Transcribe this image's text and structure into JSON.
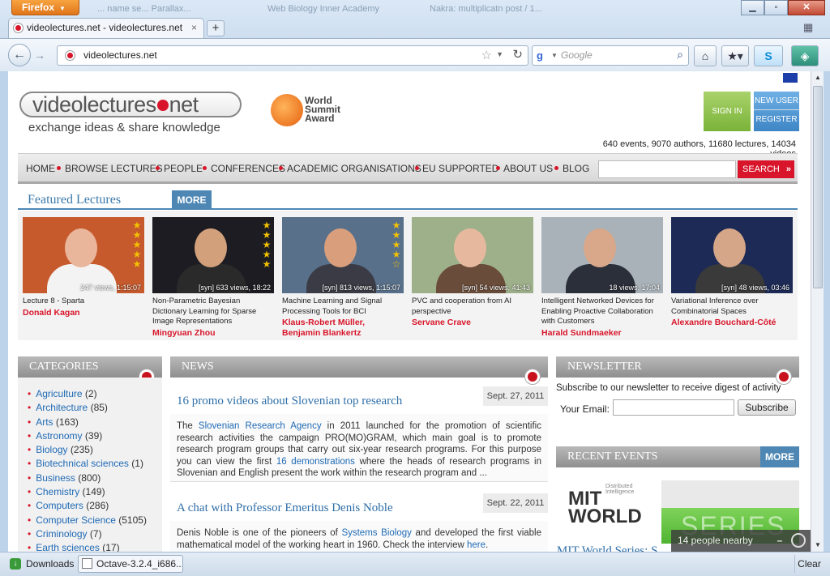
{
  "browser": {
    "app_button": "Firefox",
    "ghost_tabs": [
      "... name se... Parallax...",
      "Web Biology Inner Academy",
      "Nakra: multiplicatn post / 1..."
    ],
    "tab_title": "videolectures.net - videolectures.net",
    "url": "videolectures.net",
    "search_placeholder": "Google",
    "new_tab": "+"
  },
  "site": {
    "logo_pre": "videolectures",
    "logo_post": "net",
    "tagline": "exchange ideas & share knowledge",
    "award": [
      "World",
      "Summit",
      "Award"
    ],
    "sign_in": "SIGN IN",
    "new_user": "NEW USER",
    "register": "REGISTER",
    "stats": "640 events, 9070 authors, 11680 lectures, 14034 videos"
  },
  "menu": {
    "items": [
      "HOME",
      "BROWSE LECTURES",
      "PEOPLE",
      "CONFERENCES",
      "ACADEMIC ORGANISATIONS",
      "EU SUPPORTED",
      "ABOUT US",
      "BLOG"
    ],
    "search": "SEARCH"
  },
  "featured": {
    "title": "Featured Lectures",
    "more": "MORE",
    "cards": [
      {
        "views": "247 views, 1:15:07",
        "title": "Lecture 8 - Sparta",
        "author": "Donald Kagan",
        "stars": 5,
        "bg": "#c75a2c",
        "skin": "#e9b59b",
        "shirt": "#f3f3f3"
      },
      {
        "views": "[syn]  633 views, 18:22",
        "title": "Non-Parametric Bayesian Dictionary Learning for Sparse Image Representations",
        "author": "Mingyuan Zhou",
        "stars": 5,
        "bg": "#1c1c22",
        "skin": "#d3a07c",
        "shirt": "#2a2a2a"
      },
      {
        "views": "[syn]  813 views, 1:15:07",
        "title": "Machine Learning and Signal Processing Tools for BCI",
        "author": "Klaus-Robert Müller, Benjamin Blankertz",
        "stars": 4,
        "bg": "#58708a",
        "skin": "#d99f7d",
        "shirt": "#3b3b45"
      },
      {
        "views": "[syn]  54 views, 41:43",
        "title": "PVC and cooperation from AI perspective",
        "author": "Servane Crave",
        "stars": 0,
        "bg": "#9eb08a",
        "skin": "#e6b99f",
        "shirt": "#6a4c3a"
      },
      {
        "views": "18 views, 17:04",
        "title": "Intelligent Networked Devices for Enabling Proactive Collaboration with Customers",
        "author": "Harald Sundmaeker",
        "stars": 0,
        "bg": "#a8b2b8",
        "skin": "#d9a88a",
        "shirt": "#2b2f3a"
      },
      {
        "views": "[syn]  48 views, 03:46",
        "title": "Variational Inference over Combinatorial Spaces",
        "author": "Alexandre Bouchard-Côté",
        "stars": 0,
        "bg": "#1c2a55",
        "skin": "#d6a688",
        "shirt": "#3a3a3a"
      }
    ]
  },
  "categories": {
    "title": "CATEGORIES",
    "items": [
      {
        "name": "Agriculture",
        "count": " (2)"
      },
      {
        "name": "Architecture",
        "count": " (85)"
      },
      {
        "name": "Arts",
        "count": " (163)"
      },
      {
        "name": "Astronomy",
        "count": " (39)"
      },
      {
        "name": "Biology",
        "count": " (235)"
      },
      {
        "name": "Biotechnical sciences",
        "count": " (1)"
      },
      {
        "name": "Business",
        "count": " (800)"
      },
      {
        "name": "Chemistry",
        "count": " (149)"
      },
      {
        "name": "Computers",
        "count": " (286)"
      },
      {
        "name": "Computer Science",
        "count": " (5105)"
      },
      {
        "name": "Criminology",
        "count": " (7)"
      },
      {
        "name": "Earth sciences",
        "count": " (17)"
      }
    ]
  },
  "news": {
    "title": "NEWS",
    "items": [
      {
        "title": "16 promo videos about Slovenian top research",
        "date": "Sept. 27, 2011",
        "parts": [
          "The ",
          "Slovenian Research Agency",
          " in 2011 launched for the promotion of scientific research activities the campaign PRO(MO)GRAM, which main goal is to promote research program groups that carry out six-year research programs. For this purpose you can view the first ",
          "16 demonstrations",
          " where the heads of research programs in Slovenian and English present the work within the research program and ..."
        ]
      },
      {
        "title": "A chat with Professor Emeritus Denis Noble",
        "date": "Sept. 22, 2011",
        "parts": [
          "Denis Noble is one of the pioneers of ",
          "Systems Biology",
          " and developed the first viable mathematical model of the working heart in 1960. Check the interview ",
          "here",
          "."
        ]
      }
    ]
  },
  "newsletter": {
    "title": "NEWSLETTER",
    "text": "Subscribe to our newsletter to receive digest of activity",
    "email_label": "Your Email:",
    "subscribe": "Subscribe"
  },
  "recent_events": {
    "title": "RECENT EVENTS",
    "more": "MORE",
    "event_title": "MIT World Series: S",
    "logo_text": "MIT WORLD",
    "logo_sub": "Distributed Intelligence",
    "series": "SERIES"
  },
  "overlay": {
    "nearby": "14 people nearby",
    "minimize": "–"
  },
  "statusbar": {
    "downloads": "Downloads",
    "file": "Octave-3.2.4_i686...",
    "clear": "Clear"
  },
  "colors": {
    "brand_red": "#d8152a",
    "brand_blue": "#4e87b4",
    "signin_green": "#8cc152"
  }
}
